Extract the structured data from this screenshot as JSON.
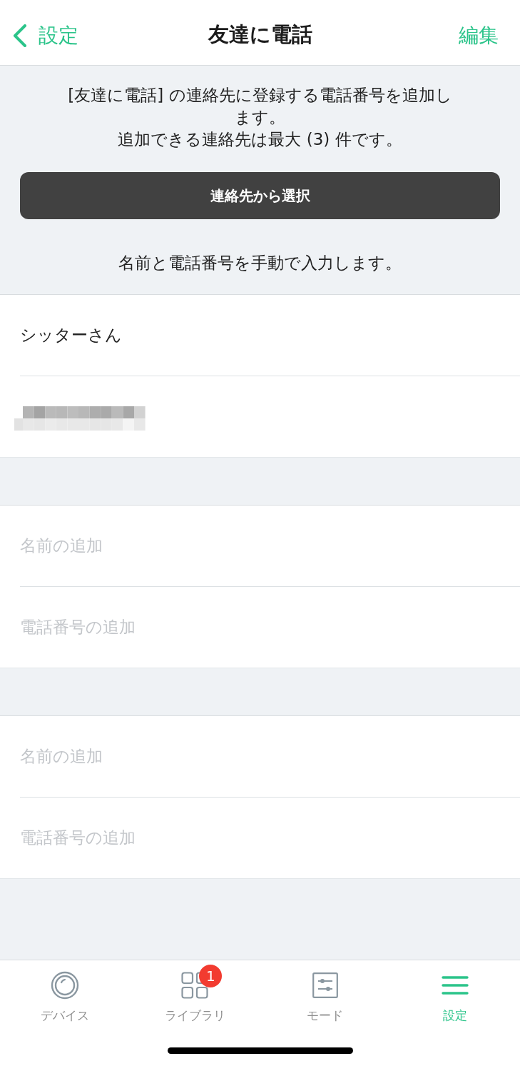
{
  "nav": {
    "back_label": "設定",
    "title": "友達に電話",
    "action": "編集"
  },
  "intro": {
    "lines": [
      "[友達に電話] の連絡先に登録する電話番号を追加します。",
      "追加できる連絡先は最大 (3) 件です。"
    ],
    "button": "連絡先から選択",
    "manual_note": "名前と電話番号を手動で入力します。"
  },
  "contacts": [
    {
      "name": {
        "value": "シッターさん"
      },
      "phone": {
        "redacted": true
      }
    },
    {
      "name": {
        "placeholder": "名前の追加"
      },
      "phone": {
        "placeholder": "電話番号の追加"
      }
    },
    {
      "name": {
        "placeholder": "名前の追加"
      },
      "phone": {
        "placeholder": "電話番号の追加"
      }
    }
  ],
  "tab_bar": {
    "tabs": [
      {
        "label": "デバイス",
        "selected": false
      },
      {
        "label": "ライブラリ",
        "selected": false,
        "badge": "1"
      },
      {
        "label": "モード",
        "selected": false
      },
      {
        "label": "設定",
        "selected": true
      }
    ]
  }
}
